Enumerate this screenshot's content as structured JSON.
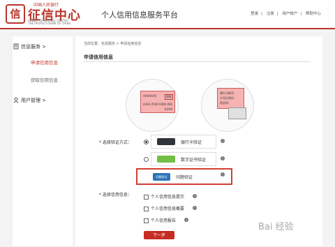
{
  "header": {
    "logo_seal_text": "信",
    "logo_small_text": "中国人民银行",
    "logo_main_text": "征信中心",
    "logo_en_line1": "CREDIT REFERENCE CENTER",
    "logo_en_line2": "THE PEOPLE'S BANK OF CHINA",
    "site_title": "个人信用信息服务平台",
    "links": [
      "登录",
      "注册",
      "用户帐户",
      "帮助中心"
    ],
    "link_separator": "|"
  },
  "sidebar": {
    "groups": [
      {
        "label": "信息服务 >",
        "icon": "document-icon"
      },
      {
        "label": "用户管理 >",
        "icon": "user-icon"
      }
    ],
    "items": [
      {
        "label": "申请信用信息",
        "active": true
      },
      {
        "label": "获取信用信息",
        "active": false
      }
    ]
  },
  "main": {
    "breadcrumb": "当前位置：信息服务 > 申请信用信息",
    "section_title": "申请信用信息",
    "left_card_lines": [
      "XXXXXXX",
      "银联",
      "4392 2500 0000 000",
      "01/09"
    ],
    "right_card_lines": [
      "银行卡帐号：",
      "卡号后四位：",
      "验证码："
    ],
    "verify_label": "* 选择验证方式：",
    "verify_options": [
      {
        "label": "银行卡验证",
        "selected": true,
        "highlighted": false,
        "icon": "bank-card-icon",
        "color": "#30353b"
      },
      {
        "label": "数字证书验证",
        "selected": false,
        "highlighted": false,
        "icon": "digital-certificate-icon",
        "color": "#73bf45"
      },
      {
        "label": "问题验证",
        "selected": false,
        "highlighted": true,
        "icon": "question-verification-icon",
        "color": "#2e73b8",
        "icon_text": "问题验证"
      }
    ],
    "info_label": "* 选择信用信息：",
    "info_options": [
      {
        "label": "个人信用信息提示",
        "checked": false
      },
      {
        "label": "个人信用信息概要",
        "checked": false
      },
      {
        "label": "个人信用报告",
        "checked": false
      }
    ],
    "next_label": "下一步"
  },
  "watermark": "Bai 经验",
  "colors": {
    "brand": "#b8352c",
    "button": "#c62d22",
    "highlight": "#d43d32"
  }
}
